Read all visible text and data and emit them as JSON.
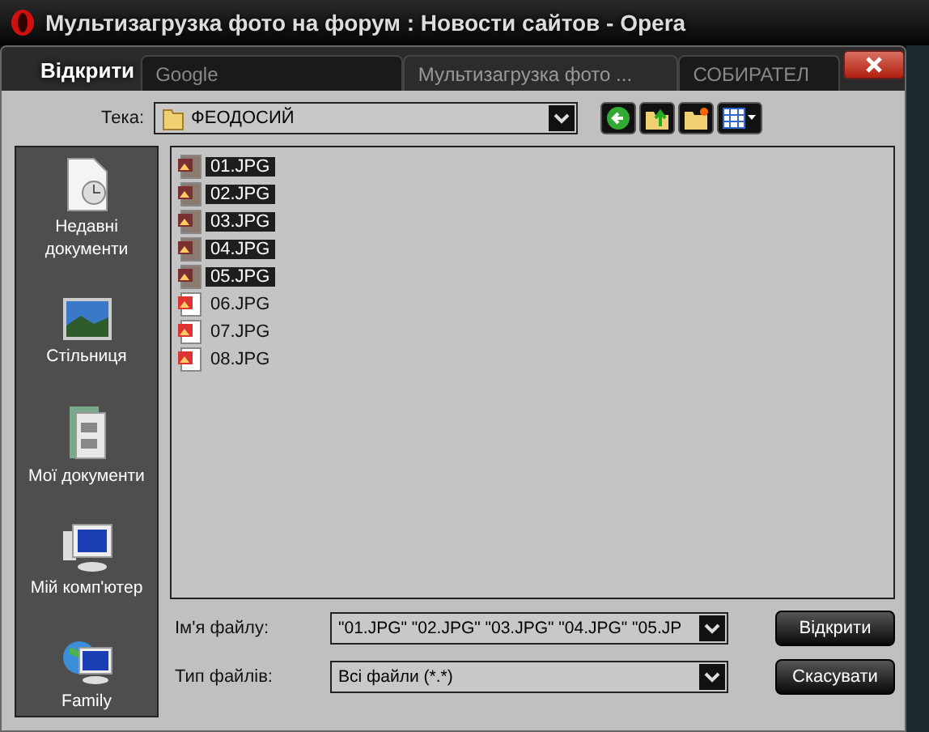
{
  "window": {
    "title": "Мультизагрузка фото на форум : Новости сайтов - Opera"
  },
  "browser_tabs": [
    {
      "label": "Google",
      "selected": false
    },
    {
      "label": "Мультизагрузка фото ...",
      "selected": true
    },
    {
      "label": "СОБИРАТЕЛ",
      "selected": false
    }
  ],
  "dialog": {
    "title": "Відкрити"
  },
  "look_in": {
    "label": "Тека:",
    "value": "ФЕОДОСИЙ"
  },
  "places": [
    {
      "kind": "recent",
      "label": "Недавні документи"
    },
    {
      "kind": "desktop",
      "label": "Стільниця"
    },
    {
      "kind": "documents",
      "label": "Мої документи"
    },
    {
      "kind": "computer",
      "label": "Мій комп'ютер"
    },
    {
      "kind": "network",
      "label": "Family"
    }
  ],
  "files": [
    {
      "name": "01.JPG",
      "selected": true
    },
    {
      "name": "02.JPG",
      "selected": true
    },
    {
      "name": "03.JPG",
      "selected": true
    },
    {
      "name": "04.JPG",
      "selected": true
    },
    {
      "name": "05.JPG",
      "selected": true
    },
    {
      "name": "06.JPG",
      "selected": false
    },
    {
      "name": "07.JPG",
      "selected": false
    },
    {
      "name": "08.JPG",
      "selected": false
    }
  ],
  "file_name": {
    "label": "Ім'я файлу:",
    "value": "\"01.JPG\" \"02.JPG\" \"03.JPG\" \"04.JPG\" \"05.JP"
  },
  "file_type": {
    "label": "Тип файлів:",
    "value": "Всі файли (*.*)"
  },
  "buttons": [
    "Відкрити",
    "Скасувати"
  ]
}
